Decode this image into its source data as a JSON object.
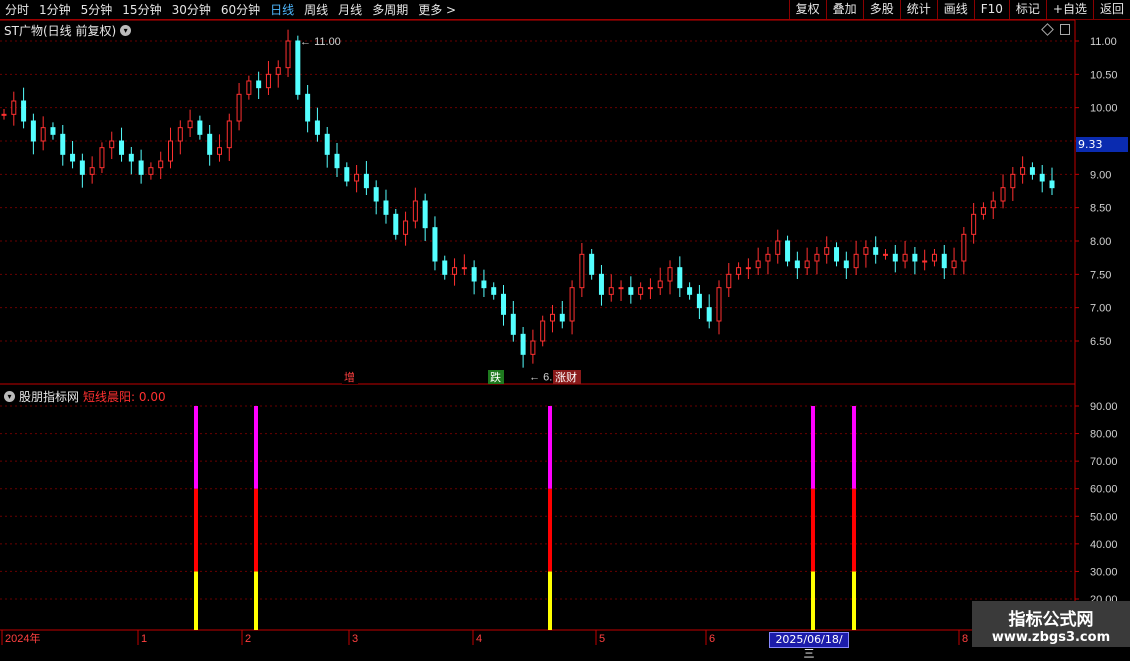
{
  "toolbar": {
    "left": [
      "分时",
      "1分钟",
      "5分钟",
      "15分钟",
      "30分钟",
      "60分钟",
      "日线",
      "周线",
      "月线",
      "多周期",
      "更多 >"
    ],
    "active_index": 6,
    "right": [
      "复权",
      "叠加",
      "多股",
      "统计",
      "画线",
      "F10",
      "标记",
      "+自选",
      "返回"
    ]
  },
  "main_panel": {
    "title": "ST广物(日线 前复权)",
    "y_ticks": [
      "11.00",
      "10.50",
      "10.00",
      "9.50",
      "9.00",
      "8.50",
      "8.00",
      "7.50",
      "7.00",
      "6.50"
    ],
    "y_tick_values": [
      11.0,
      10.5,
      10.0,
      9.5,
      9.0,
      8.5,
      8.0,
      7.5,
      7.0,
      6.5
    ],
    "current_price": "9.33",
    "high_label": "11.00",
    "low_label": "6.12",
    "markers": [
      {
        "label": "增",
        "color": "#ff4040",
        "bg": "#000000"
      },
      {
        "label": "跌",
        "color": "#ffffff",
        "bg": "#1e7a1e"
      },
      {
        "label": "涨财",
        "color": "#ffffff",
        "bg": "#8a1a1a"
      }
    ]
  },
  "indicator_panel": {
    "name": "股朋指标网",
    "series_label": "短线晨阳: 0.00",
    "y_ticks": [
      "90.00",
      "80.00",
      "70.00",
      "60.00",
      "50.00",
      "40.00",
      "30.00",
      "20.00"
    ],
    "y_tick_values": [
      90,
      80,
      70,
      60,
      50,
      40,
      30,
      20
    ]
  },
  "chart_data": {
    "type": "bar",
    "title": "短线晨阳",
    "note_segments": {
      "yellow": [
        0,
        30
      ],
      "red": [
        30,
        60
      ],
      "magenta": [
        60,
        90
      ]
    },
    "signals": [
      "2024-01",
      "2024-02",
      "2024-04",
      "2025-06",
      "2025-06"
    ],
    "values": [
      90,
      90,
      90,
      90,
      90
    ],
    "ylim": [
      15,
      95
    ]
  },
  "x_axis": {
    "labels": [
      "2024年",
      "1",
      "2",
      "3",
      "4",
      "5",
      "6",
      "7",
      "8"
    ],
    "cursor_date": "2025/06/18/三"
  },
  "candles_close_path": [
    9.9,
    10.1,
    9.8,
    9.5,
    9.7,
    9.6,
    9.3,
    9.2,
    9.0,
    9.1,
    9.4,
    9.5,
    9.3,
    9.2,
    9.0,
    9.1,
    9.2,
    9.5,
    9.7,
    9.8,
    9.6,
    9.3,
    9.4,
    9.8,
    10.2,
    10.4,
    10.3,
    10.5,
    10.6,
    11.0,
    10.2,
    9.8,
    9.6,
    9.3,
    9.1,
    8.9,
    9.0,
    8.8,
    8.6,
    8.4,
    8.1,
    8.3,
    8.6,
    8.2,
    7.7,
    7.5,
    7.6,
    7.6,
    7.4,
    7.3,
    7.2,
    6.9,
    6.6,
    6.3,
    6.5,
    6.8,
    6.9,
    6.8,
    7.3,
    7.8,
    7.5,
    7.2,
    7.3,
    7.3,
    7.2,
    7.3,
    7.3,
    7.4,
    7.6,
    7.3,
    7.2,
    7.0,
    6.8,
    7.3,
    7.5,
    7.6,
    7.6,
    7.7,
    7.8,
    8.0,
    7.7,
    7.6,
    7.7,
    7.8,
    7.9,
    7.7,
    7.6,
    7.8,
    7.9,
    7.8,
    7.8,
    7.7,
    7.8,
    7.7,
    7.7,
    7.8,
    7.6,
    7.7,
    8.1,
    8.4,
    8.5,
    8.6,
    8.8,
    9.0,
    9.1,
    9.0,
    8.9,
    8.8
  ],
  "watermark": {
    "line1": "指标公式网",
    "line2": "www.zbgs3.com"
  }
}
